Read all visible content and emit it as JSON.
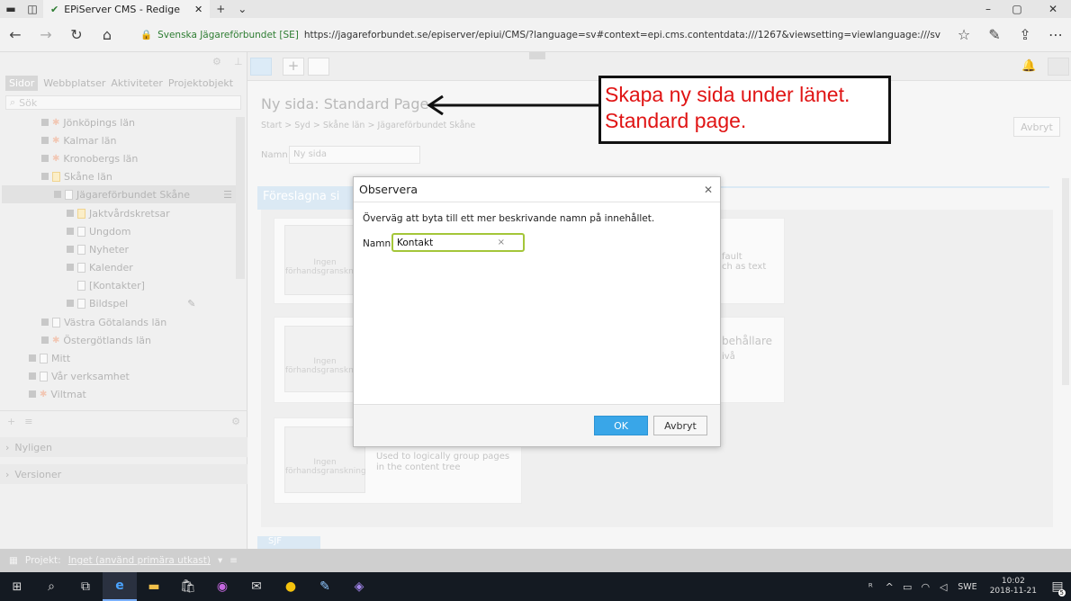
{
  "browser": {
    "tab_title": "EPiServer CMS - Redige",
    "site_identity": "Svenska Jägareförbundet [SE]",
    "url": "https://jagareforbundet.se/episerver/epiui/CMS/?language=sv#context=epi.cms.contentdata:///1267&viewsetting=viewlanguage:///sv"
  },
  "left": {
    "tabs": [
      "Sidor",
      "Webbplatser",
      "Aktiviteter",
      "Projektobjekt"
    ],
    "search_placeholder": "Sök",
    "tree": [
      {
        "label": "Jönköpings län"
      },
      {
        "label": "Kalmar län"
      },
      {
        "label": "Kronobergs län"
      },
      {
        "label": "Skåne län"
      },
      {
        "label": "Jägareförbundet Skåne"
      },
      {
        "label": "Jaktvårdskretsar"
      },
      {
        "label": "Ungdom"
      },
      {
        "label": "Nyheter"
      },
      {
        "label": "Kalender"
      },
      {
        "label": "[Kontakter]"
      },
      {
        "label": "Bildspel"
      },
      {
        "label": "Västra Götalands län"
      },
      {
        "label": "Östergötlands län"
      },
      {
        "label": "Mitt"
      },
      {
        "label": "Vår verksamhet"
      },
      {
        "label": "Viltmat"
      }
    ],
    "recent_label": "Nyligen",
    "versions_label": "Versioner"
  },
  "main": {
    "title": "Ny sida: Standard Page",
    "breadcrumb": "Start > Syd > Skåne län > Jägareförbundet Skåne",
    "name_label": "Namn",
    "name_value": "Ny sida",
    "cancel_label": "Avbryt",
    "suggested_heading": "Föreslagna si",
    "card1_text": "fault\nch as text",
    "card2_title": "behållare",
    "card2_text": "ivå",
    "card3_text": "Used to logically group pages in the content tree",
    "thumb_text": "Ingen förhandsgranskning",
    "bottom_tab": "SJF"
  },
  "dialog": {
    "title": "Observera",
    "message": "Överväg att byta till ett mer beskrivande namn på innehållet.",
    "name_label": "Namn",
    "name_value": "Kontakt",
    "ok_label": "OK",
    "cancel_label": "Avbryt"
  },
  "annotation": {
    "text": "Skapa ny sida under länet. Standard page."
  },
  "footer": {
    "project_label": "Projekt:",
    "project_value": "Inget (använd primära utkast)"
  },
  "taskbar": {
    "language": "SWE",
    "time": "10:02",
    "date": "2018-11-21",
    "notifications": "5"
  },
  "colors": {
    "accent": "#39a6e8",
    "annotation_red": "#e01414",
    "input_focus": "#a4c639"
  }
}
